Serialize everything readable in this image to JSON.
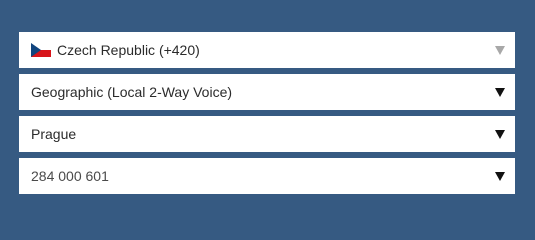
{
  "selects": {
    "country": {
      "value": "Czech Republic (+420)",
      "flag_icon": "czech-flag-icon",
      "arrow_color": "#a8a8a8"
    },
    "number_type": {
      "value": "Geographic (Local 2-Way Voice)"
    },
    "city": {
      "value": "Prague"
    },
    "phone_number": {
      "value": "284 000 601"
    }
  },
  "colors": {
    "background": "#365a82",
    "field": "#ffffff",
    "text": "#2b2b2b"
  }
}
